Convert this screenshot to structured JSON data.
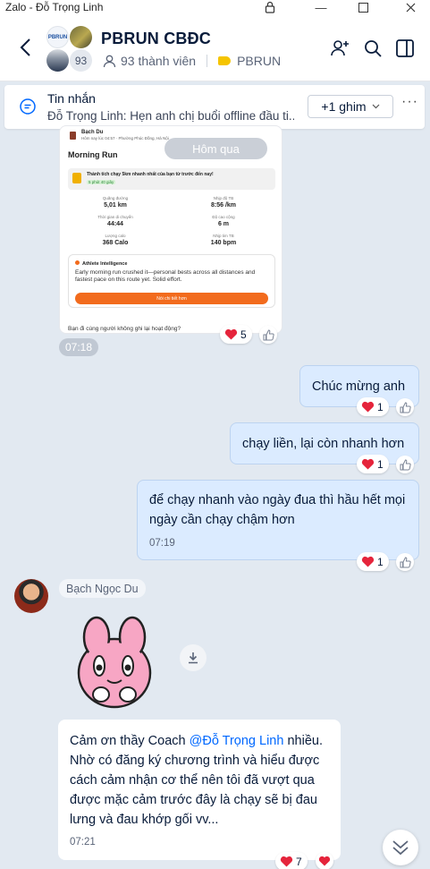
{
  "window": {
    "title": "Zalo - Đỗ Trọng Linh"
  },
  "header": {
    "group_name": "PBRUN CBĐC",
    "member_count_badge": "93",
    "members_label": "93 thành viên",
    "tag_label": "PBRUN",
    "tag_color": "#f5c400",
    "group_avatar_text": "PBRUN"
  },
  "pinned": {
    "title": "Tin nhắn",
    "text": "Đỗ Trọng Linh: Hẹn anh chị buổi offline đầu ti...",
    "pins_label": "+1 ghim",
    "more": "···"
  },
  "shared_image": {
    "club": "Bạch Du",
    "meta": "Hôm nay lúc 04:57 · Phường Phúc Đồng, Hà Nội",
    "title": "Morning Run",
    "achievement": "Thành tích chạy 5km nhanh nhất của bạn từ trước đến nay!",
    "achievement_badge": "5 phút 40 giây",
    "stats": [
      {
        "label": "Quãng đường",
        "value": "5,01 km"
      },
      {
        "label": "Nhịp độ TB",
        "value": "8:56 /km"
      },
      {
        "label": "Thời gian di chuyển",
        "value": "44:44"
      },
      {
        "label": "Độ cao cộng",
        "value": "6 m"
      },
      {
        "label": "Lượng calo",
        "value": "368 Calo"
      },
      {
        "label": "Nhịp tim TB",
        "value": "140 bpm"
      }
    ],
    "ai_title": "Athlete Intelligence",
    "ai_text": "Early morning run crushed it—personal bests across all distances and fastest pace on this route yet. Solid effort.",
    "ai_button": "Nói chi tiết hơn",
    "footer": "Bạn đi cùng người không ghi lại hoạt động?",
    "date_pill": "Hôm qua",
    "time": "07:18",
    "reaction_count": "5"
  },
  "messages": [
    {
      "text": "Chúc mừng anh",
      "reaction_count": "1"
    },
    {
      "text": "chạy liền, lại còn nhanh hơn",
      "reaction_count": "1"
    },
    {
      "text": "để chạy nhanh vào ngày đua thì hầu hết mọi ngày cần chạy chậm hơn",
      "time": "07:19",
      "reaction_count": "1"
    }
  ],
  "incoming": {
    "sender": "Bạch Ngọc Du",
    "text_before": "Cảm ơn thầy Coach ",
    "mention": "@Đỗ Trọng Linh",
    "text_after": " nhiều. Nhờ có đăng ký chương trình và hiểu được cách cảm nhận cơ thể nên tôi đã vượt qua được mặc cảm trước đây là chạy sẽ bị đau lưng và đau khớp gối vv...",
    "time": "07:21",
    "reaction_count": "7"
  },
  "colors": {
    "accent": "#0068ff",
    "heart": "#e5243b",
    "bubble_me": "#dbebff",
    "background": "#e2e9f1",
    "strava_orange": "#f26b1d"
  },
  "icons": [
    "lock-icon",
    "minimize-icon",
    "maximize-icon",
    "close-icon",
    "back-icon",
    "add-member-icon",
    "search-icon",
    "sidebar-toggle-icon",
    "message-icon",
    "chevron-down-icon",
    "heart-icon",
    "like-icon",
    "download-icon",
    "scroll-down-icon"
  ]
}
